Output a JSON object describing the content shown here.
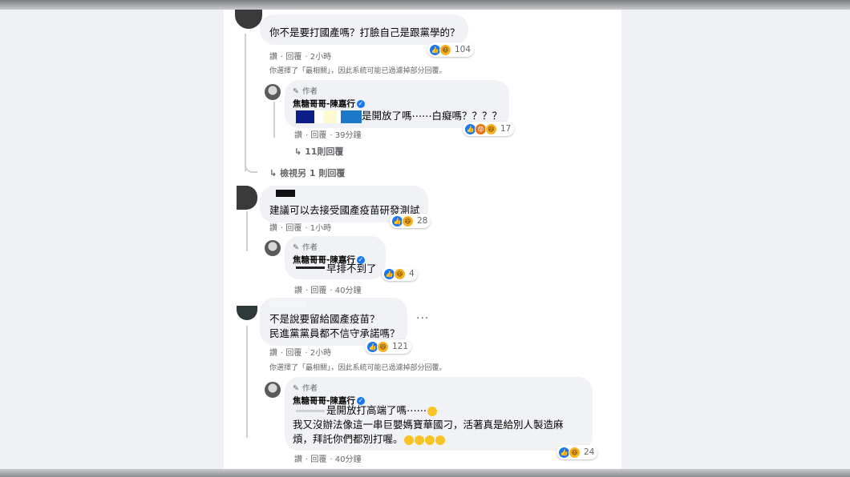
{
  "comments": [
    {
      "text": "你不是要打國產嗎？打臉自己是跟黨學的？",
      "like": "讚",
      "reply": "回覆",
      "time": "2小時",
      "reactions": "104",
      "filter_note": "你選擇了「最相關」，因此系統可能已過濾掉部分回覆。"
    },
    {
      "text": "建議可以去接受國產疫苗研發測試",
      "like": "讚",
      "reply": "回覆",
      "time": "1小時",
      "reactions": "28"
    },
    {
      "line1": "不是說要留給國產疫苗？",
      "line2": "民進黨黨員都不信守承諾嗎？",
      "like": "讚",
      "reply": "回覆",
      "time": "2小時",
      "reactions": "121",
      "more": "···",
      "filter_note": "你選擇了「最相關」，因此系統可能已過濾掉部分回覆。"
    }
  ],
  "author": {
    "tag": "作者",
    "name": "焦糖哥哥-陳嘉行",
    "verified": "✓"
  },
  "replies": [
    {
      "text": "是開放了嗎⋯⋯白癡嗎？？？？",
      "like": "讚",
      "reply": "回覆",
      "time": "39分鐘",
      "reactions": "17",
      "more_replies": "11則回覆"
    },
    {
      "text": "早排不到了",
      "like": "讚",
      "reply": "回覆",
      "time": "40分鐘",
      "reactions": "4"
    },
    {
      "line1": "是開放打高端了嗎⋯⋯",
      "line2": "我又沒辦法像這一串巨嬰媽寶華國刁，活著真是給別人製造麻",
      "line3": "煩，拜託你們都別打喔。",
      "like": "讚",
      "reply": "回覆",
      "time": "40分鐘",
      "reactions": "24"
    }
  ],
  "view_more": "檢視另 1 則回覆",
  "arrow": "↳",
  "icons": {
    "pencil": "✎"
  },
  "colors": {
    "like_blue": "#1877f2",
    "haha_yellow": "#f7b125",
    "angry_orange": "#e9710f",
    "bubble": "#f0f2f5",
    "meta_gray": "#65676b"
  }
}
